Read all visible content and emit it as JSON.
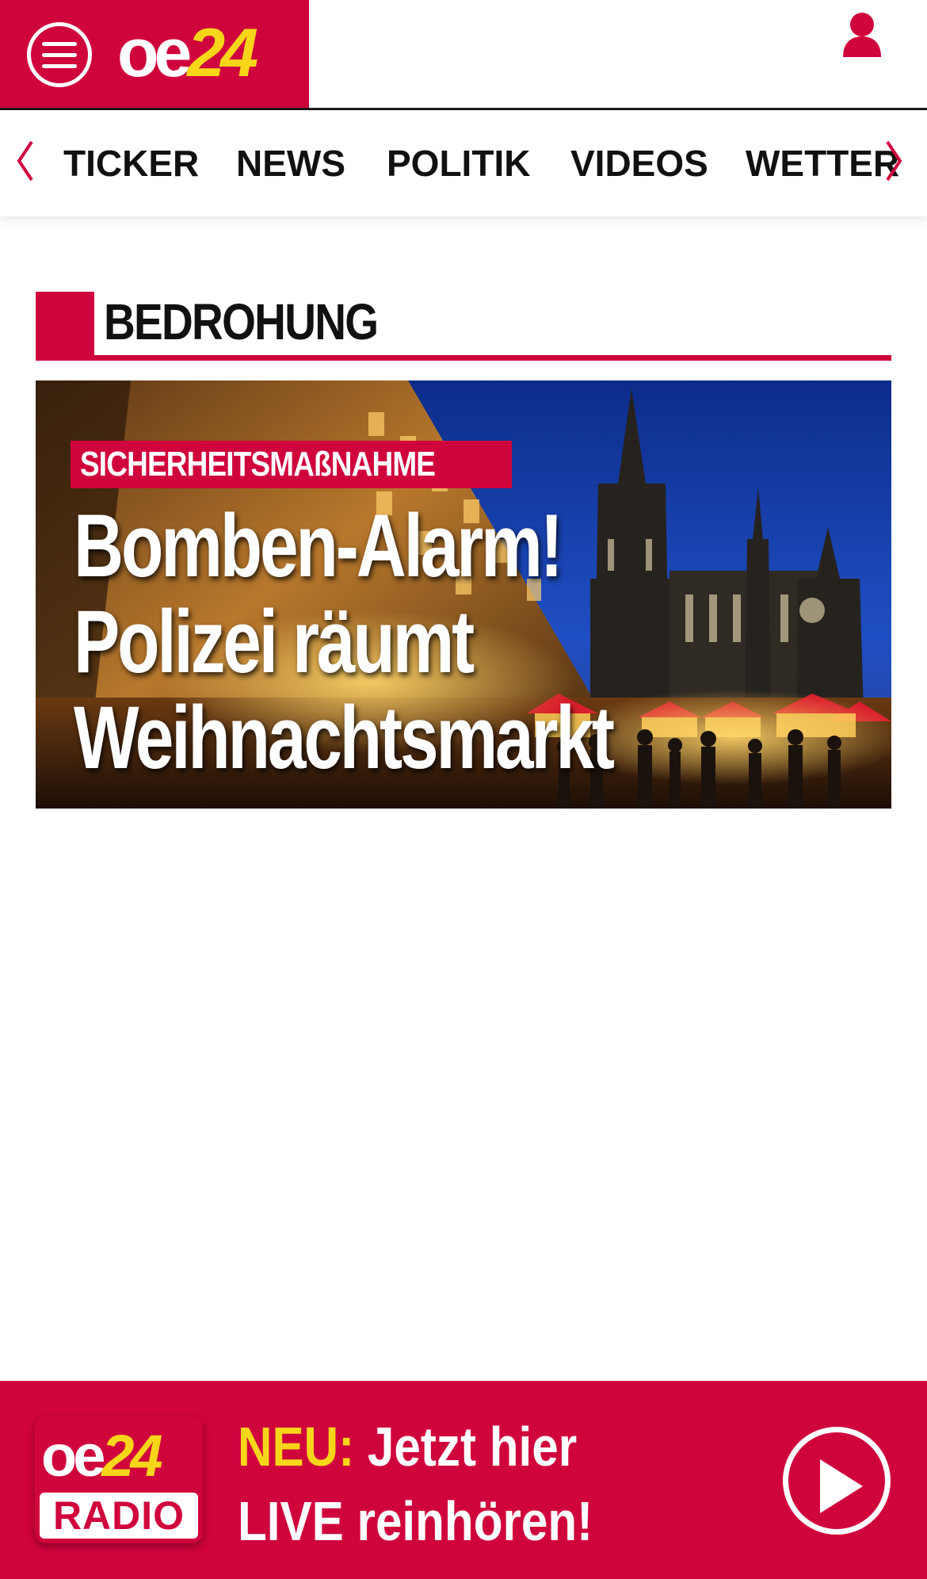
{
  "header": {
    "menu_icon": "hamburger-menu-icon",
    "logo": {
      "part1": "oe",
      "part2": "24"
    },
    "user_icon": "user-account-icon",
    "brand_color": "#d0043c",
    "logo_accent_color": "#f7d61a"
  },
  "nav": {
    "prev_icon": "chevron-left-icon",
    "next_icon": "chevron-right-icon",
    "items": [
      {
        "label": "TICKER"
      },
      {
        "label": "NEWS"
      },
      {
        "label": "POLITIK"
      },
      {
        "label": "VIDEOS"
      },
      {
        "label": "WETTER"
      }
    ]
  },
  "section": {
    "title": "BEDROHUNG"
  },
  "hero": {
    "kicker": "SICHERHEITSMAßNAHME",
    "headline_lines": [
      "Bomben-Alarm!",
      "Polizei räumt",
      "Weihnachtsmarkt"
    ],
    "image_subject": "cathedral-christmas-market-night-photo"
  },
  "radio_banner": {
    "logo": {
      "part1": "oe",
      "part2": "24",
      "radio": "RADIO"
    },
    "neu": "NEU:",
    "text_line1": "Jetzt hier",
    "text_line2": "LIVE reinhören!",
    "play_icon": "play-icon"
  }
}
